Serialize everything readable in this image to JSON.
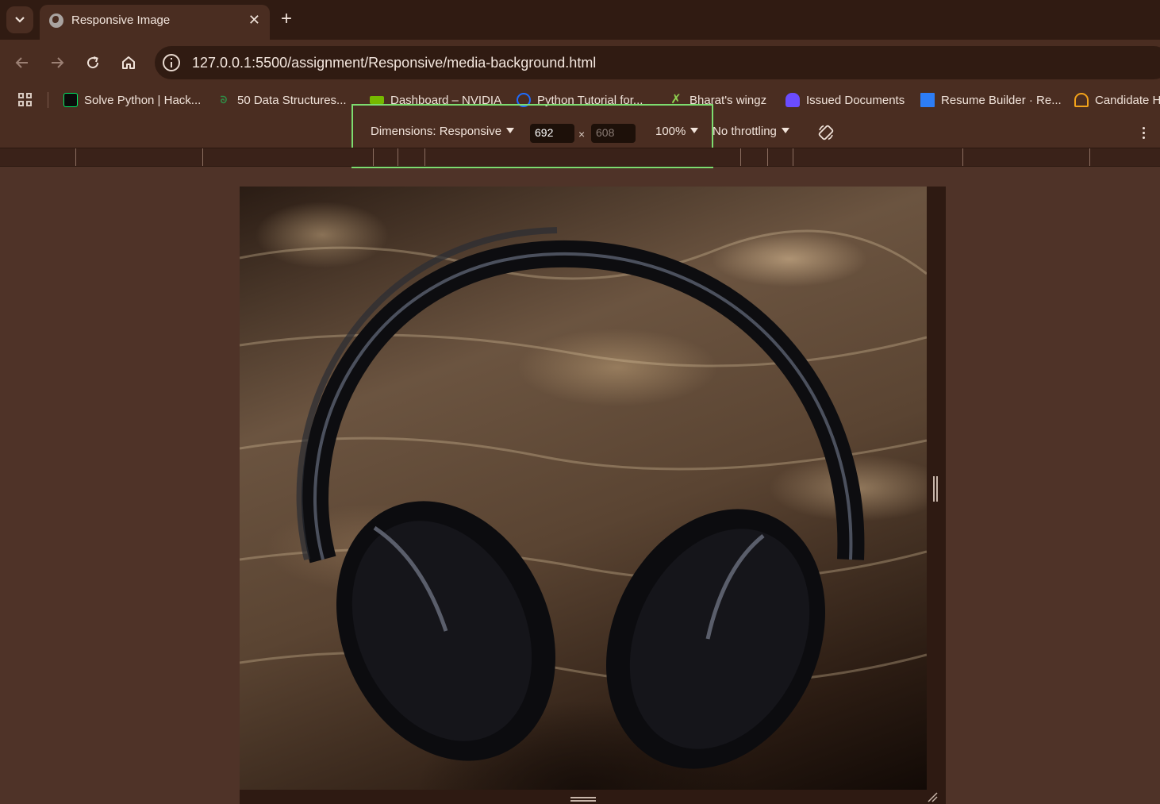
{
  "browser": {
    "tab": {
      "title": "Responsive Image"
    },
    "address_bar": {
      "url": "127.0.0.1:5500/assignment/Responsive/media-background.html"
    },
    "bookmarks": [
      {
        "label": "Solve Python | Hack...",
        "icon": "hackerrank-icon",
        "color": "#00ea64"
      },
      {
        "label": "50 Data Structures...",
        "icon": "geeksforgeeks-icon",
        "color": "#2f8d46"
      },
      {
        "label": "Dashboard – NVIDIA",
        "icon": "nvidia-icon",
        "color": "#76b900"
      },
      {
        "label": "Python Tutorial for...",
        "icon": "python-tutorial-icon",
        "color": "#1e6cff"
      },
      {
        "label": "Bharat's wingz",
        "icon": "wingz-icon",
        "color": "#8fd14f"
      },
      {
        "label": "Issued Documents",
        "icon": "digilocker-icon",
        "color": "#6a4cff"
      },
      {
        "label": "Resume Builder · Re...",
        "icon": "resume-builder-icon",
        "color": "#2d7df6"
      },
      {
        "label": "Candidate H",
        "icon": "candidate-icon",
        "color": "#f2a21a"
      }
    ]
  },
  "devtools": {
    "dimensions_label": "Dimensions: Responsive",
    "width": "692",
    "height_placeholder": "608",
    "times": "×",
    "zoom": "100%",
    "throttling": "No throttling"
  },
  "viewport": {
    "image_subject": "headphones-on-fur-photo"
  },
  "colors": {
    "page_bg": "#4f3328",
    "chrome_bg": "#4a2d21",
    "tabstrip_bg": "#301b12",
    "highlight": "#7ddc6f"
  }
}
